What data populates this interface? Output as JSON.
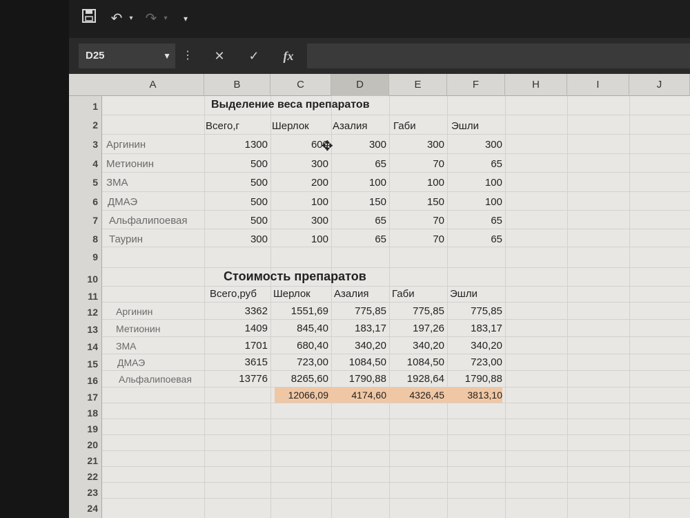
{
  "toolbar": {
    "save_icon": "save-icon",
    "undo_icon": "undo-icon",
    "redo_icon": "redo-icon",
    "customize_icon": "customize-qat-icon"
  },
  "formula_bar": {
    "name_box": "D25",
    "cancel_glyph": "✕",
    "enter_glyph": "✓",
    "fx_label": "fx",
    "value": ""
  },
  "columns": [
    "A",
    "B",
    "C",
    "D",
    "E",
    "F",
    "H",
    "I",
    "J"
  ],
  "selected_column": "D",
  "rows": [
    "1",
    "2",
    "3",
    "4",
    "5",
    "6",
    "7",
    "8",
    "9",
    "10",
    "11",
    "12",
    "13",
    "14",
    "15",
    "16",
    "17",
    "18",
    "19",
    "20",
    "21",
    "22",
    "23",
    "24"
  ],
  "weights": {
    "title": "Выделение веса препаратов",
    "headers": [
      "Всего,г",
      "Шерлок",
      "Азалия",
      "Габи",
      "Эшли"
    ],
    "items": [
      {
        "name": "Аргинин",
        "values": [
          "1300",
          "600",
          "300",
          "300",
          "300"
        ]
      },
      {
        "name": "Метионин",
        "values": [
          "500",
          "300",
          "65",
          "70",
          "65"
        ]
      },
      {
        "name": "ЗМА",
        "values": [
          "500",
          "200",
          "100",
          "100",
          "100"
        ]
      },
      {
        "name": "ДМАЭ",
        "values": [
          "500",
          "100",
          "150",
          "150",
          "100"
        ]
      },
      {
        "name": "Альфалипоевая",
        "values": [
          "500",
          "300",
          "65",
          "70",
          "65"
        ]
      },
      {
        "name": "Таурин",
        "values": [
          "300",
          "100",
          "65",
          "70",
          "65"
        ]
      }
    ]
  },
  "costs": {
    "title": "Стоимость препаратов",
    "headers": [
      "Всего,руб",
      "Шерлок",
      "Азалия",
      "Габи",
      "Эшли"
    ],
    "items": [
      {
        "name": "Аргинин",
        "values": [
          "3362",
          "1551,69",
          "775,85",
          "775,85",
          "775,85"
        ]
      },
      {
        "name": "Метионин",
        "values": [
          "1409",
          "845,40",
          "183,17",
          "197,26",
          "183,17"
        ]
      },
      {
        "name": "ЗМА",
        "values": [
          "1701",
          "680,40",
          "340,20",
          "340,20",
          "340,20"
        ]
      },
      {
        "name": "ДМАЭ",
        "values": [
          "3615",
          "723,00",
          "1084,50",
          "1084,50",
          "723,00"
        ]
      },
      {
        "name": "Альфалипоевая",
        "values": [
          "13776",
          "8265,60",
          "1790,88",
          "1928,64",
          "1790,88"
        ]
      }
    ],
    "totals": [
      "12066,09",
      "4174,60",
      "4326,45",
      "3813,10"
    ]
  },
  "colors": {
    "total_fill": "#f0c7a4",
    "label_text": "#6a6a6a"
  }
}
